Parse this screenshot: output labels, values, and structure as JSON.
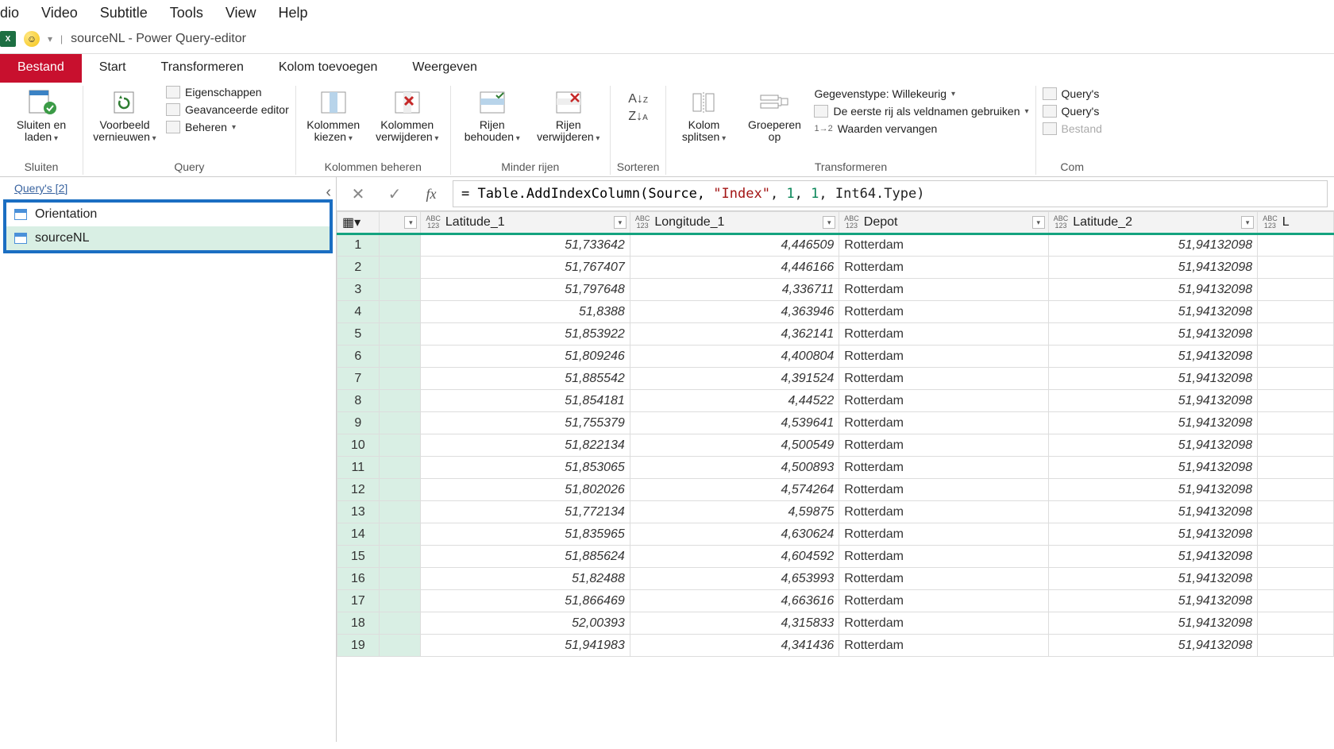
{
  "top_menu": {
    "items": [
      "dio",
      "Video",
      "Subtitle",
      "Tools",
      "View",
      "Help"
    ]
  },
  "qat": {
    "excel": "X",
    "title": "sourceNL - Power Query-editor"
  },
  "ribbon_tabs": {
    "bestand": "Bestand",
    "start": "Start",
    "transformeren": "Transformeren",
    "kolom": "Kolom toevoegen",
    "weergeven": "Weergeven"
  },
  "ribbon": {
    "sluiten_laden": "Sluiten en\nladen",
    "sluiten_group": "Sluiten",
    "voorbeeld": "Voorbeeld\nvernieuwen",
    "eigenschappen": "Eigenschappen",
    "geavanceerde": "Geavanceerde editor",
    "beheren": "Beheren",
    "query_group": "Query",
    "kolommen_kiezen": "Kolommen\nkiezen",
    "kolommen_verwijderen": "Kolommen\nverwijderen",
    "kolommen_group": "Kolommen beheren",
    "rijen_behouden": "Rijen\nbehouden",
    "rijen_verwijderen": "Rijen\nverwijderen",
    "rijen_group": "Minder rijen",
    "sorteren_group": "Sorteren",
    "kolom_splitsen": "Kolom\nsplitsen",
    "groeperen": "Groeperen\nop",
    "gegevenstype": "Gegevenstype: Willekeurig",
    "eerste_rij": "De eerste rij als veldnamen gebruiken",
    "waarden": "Waarden vervangen",
    "transformeren_group": "Transformeren",
    "querys_right1": "Query's",
    "querys_right2": "Query's",
    "bestand_right": "Bestand",
    "com_group": "Com"
  },
  "queries": {
    "header": "Query's [2]",
    "items": [
      "Orientation",
      "sourceNL"
    ],
    "selected": 1
  },
  "formula": {
    "prefix": "= Table.AddIndexColumn(Source, ",
    "str": "\"Index\"",
    "mid": ", ",
    "n1": "1",
    "n2": "1",
    "tail": ", Int64.Type)"
  },
  "columns": [
    "Latitude_1",
    "Longitude_1",
    "Depot",
    "Latitude_2",
    "L"
  ],
  "rows": [
    {
      "n": 1,
      "lat1": "51,733642",
      "lon1": "4,446509",
      "depot": "Rotterdam",
      "lat2": "51,94132098"
    },
    {
      "n": 2,
      "lat1": "51,767407",
      "lon1": "4,446166",
      "depot": "Rotterdam",
      "lat2": "51,94132098"
    },
    {
      "n": 3,
      "lat1": "51,797648",
      "lon1": "4,336711",
      "depot": "Rotterdam",
      "lat2": "51,94132098"
    },
    {
      "n": 4,
      "lat1": "51,8388",
      "lon1": "4,363946",
      "depot": "Rotterdam",
      "lat2": "51,94132098"
    },
    {
      "n": 5,
      "lat1": "51,853922",
      "lon1": "4,362141",
      "depot": "Rotterdam",
      "lat2": "51,94132098"
    },
    {
      "n": 6,
      "lat1": "51,809246",
      "lon1": "4,400804",
      "depot": "Rotterdam",
      "lat2": "51,94132098"
    },
    {
      "n": 7,
      "lat1": "51,885542",
      "lon1": "4,391524",
      "depot": "Rotterdam",
      "lat2": "51,94132098"
    },
    {
      "n": 8,
      "lat1": "51,854181",
      "lon1": "4,44522",
      "depot": "Rotterdam",
      "lat2": "51,94132098"
    },
    {
      "n": 9,
      "lat1": "51,755379",
      "lon1": "4,539641",
      "depot": "Rotterdam",
      "lat2": "51,94132098"
    },
    {
      "n": 10,
      "lat1": "51,822134",
      "lon1": "4,500549",
      "depot": "Rotterdam",
      "lat2": "51,94132098"
    },
    {
      "n": 11,
      "lat1": "51,853065",
      "lon1": "4,500893",
      "depot": "Rotterdam",
      "lat2": "51,94132098"
    },
    {
      "n": 12,
      "lat1": "51,802026",
      "lon1": "4,574264",
      "depot": "Rotterdam",
      "lat2": "51,94132098"
    },
    {
      "n": 13,
      "lat1": "51,772134",
      "lon1": "4,59875",
      "depot": "Rotterdam",
      "lat2": "51,94132098"
    },
    {
      "n": 14,
      "lat1": "51,835965",
      "lon1": "4,630624",
      "depot": "Rotterdam",
      "lat2": "51,94132098"
    },
    {
      "n": 15,
      "lat1": "51,885624",
      "lon1": "4,604592",
      "depot": "Rotterdam",
      "lat2": "51,94132098"
    },
    {
      "n": 16,
      "lat1": "51,82488",
      "lon1": "4,653993",
      "depot": "Rotterdam",
      "lat2": "51,94132098"
    },
    {
      "n": 17,
      "lat1": "51,866469",
      "lon1": "4,663616",
      "depot": "Rotterdam",
      "lat2": "51,94132098"
    },
    {
      "n": 18,
      "lat1": "52,00393",
      "lon1": "4,315833",
      "depot": "Rotterdam",
      "lat2": "51,94132098"
    },
    {
      "n": 19,
      "lat1": "51,941983",
      "lon1": "4,341436",
      "depot": "Rotterdam",
      "lat2": "51,94132098"
    }
  ]
}
